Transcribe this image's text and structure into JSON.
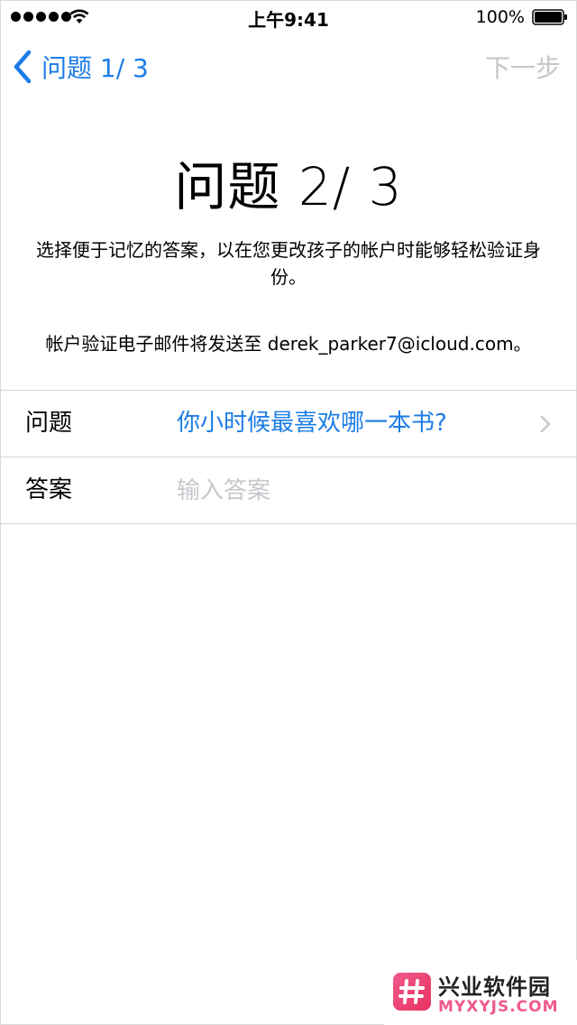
{
  "status_bar": {
    "time": "上午9:41",
    "battery_percent": "100%",
    "signal_bars": 5,
    "battery_level": 1.0
  },
  "nav": {
    "back_label": "问题 1/ 3",
    "next_label": "下一步"
  },
  "header": {
    "title": "问题 2/ 3",
    "description": "选择便于记忆的答案，以在您更改孩子的帐户时能够轻松验证身份。",
    "email_note": "帐户验证电子邮件将发送至 derek_parker7@icloud.com。"
  },
  "form": {
    "question_label": "问题",
    "question_value": "你小时候最喜欢哪一本书?",
    "answer_label": "答案",
    "answer_placeholder": "输入答案",
    "answer_value": ""
  },
  "watermark": {
    "name": "兴业软件园",
    "url": "MYXYJS.COM"
  },
  "colors": {
    "accent": "#1b7ce6",
    "disabled": "#c6c6c6",
    "separator": "#d4d4d4",
    "watermark": "#f05a8c"
  },
  "icons": {
    "back": "chevron-left-icon",
    "row_disclosure": "chevron-right-icon",
    "wifi": "wifi-icon",
    "battery": "battery-icon"
  }
}
